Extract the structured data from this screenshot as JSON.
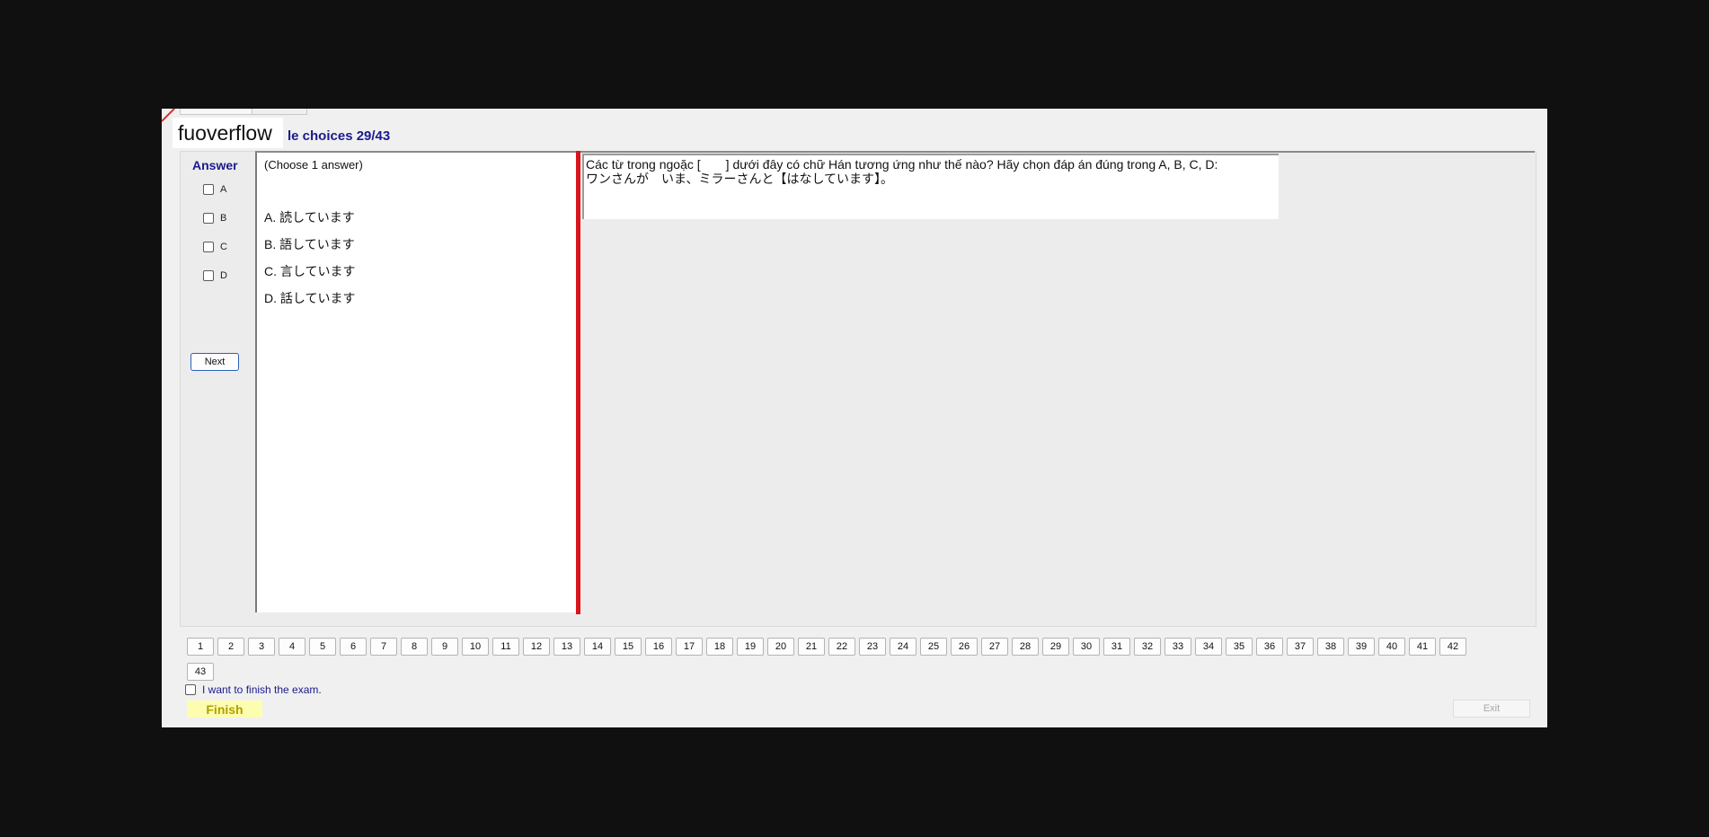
{
  "app": {
    "brand": "fuoverflow",
    "section_title": "le choices 29/43"
  },
  "answer_panel": {
    "title": "Answer",
    "options": [
      "A",
      "B",
      "C",
      "D"
    ],
    "next_label": "Next"
  },
  "choices": {
    "instruction": "(Choose 1 answer)",
    "items": [
      "A.  読しています",
      "B.  語しています",
      "C.  言しています",
      "D.  話しています"
    ]
  },
  "question": {
    "line1_before": "Các từ trong ngoặc [",
    "line1_after": "] dưới đây có chữ Hán tương ứng như thế nào? Hãy chọn đáp án đúng trong A, B, C, D:",
    "line2": "ワンさんが　いま、ミラーさんと【はなしています】。"
  },
  "pager": {
    "pages": [
      "1",
      "2",
      "3",
      "4",
      "5",
      "6",
      "7",
      "8",
      "9",
      "10",
      "11",
      "12",
      "13",
      "14",
      "15",
      "16",
      "17",
      "18",
      "19",
      "20",
      "21",
      "22",
      "23",
      "24",
      "25",
      "26",
      "27",
      "28",
      "29",
      "30",
      "31",
      "32",
      "33",
      "34",
      "35",
      "36",
      "37",
      "38",
      "39",
      "40",
      "41",
      "42",
      "43"
    ]
  },
  "finish": {
    "checkbox_label": "I want to finish the exam.",
    "finish_label": "Finish",
    "exit_label": "Exit"
  },
  "colors": {
    "accent_blue": "#1a1a8c",
    "splitter_red": "#d8141c",
    "finish_yellow": "#fdfdb0"
  }
}
